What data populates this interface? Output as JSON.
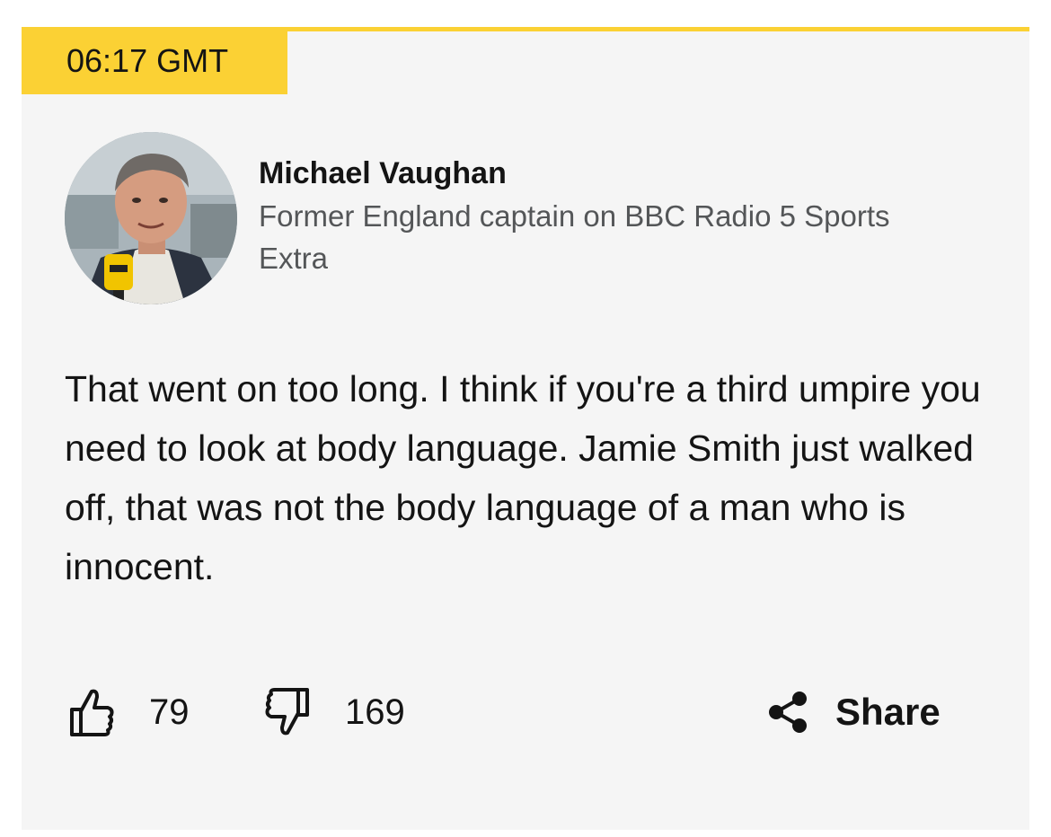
{
  "post": {
    "timestamp": "06:17 GMT",
    "contributor": {
      "name": "Michael Vaughan",
      "role": "Former England captain on BBC Radio 5 Sports Extra",
      "avatar_icon": "contributor-photo"
    },
    "body": "That went on too long. I think if you're a third umpire you need to look at body language. Jamie Smith just walked off, that was not the body language of a man who is innocent.",
    "reactions": {
      "like_icon": "thumbs-up-icon",
      "like_count": "79",
      "dislike_icon": "thumbs-down-icon",
      "dislike_count": "169"
    },
    "share": {
      "icon": "share-icon",
      "label": "Share"
    }
  },
  "colors": {
    "accent": "#fbd134",
    "card_background": "#f5f5f5",
    "text": "#141414",
    "secondary_text": "#545658"
  }
}
